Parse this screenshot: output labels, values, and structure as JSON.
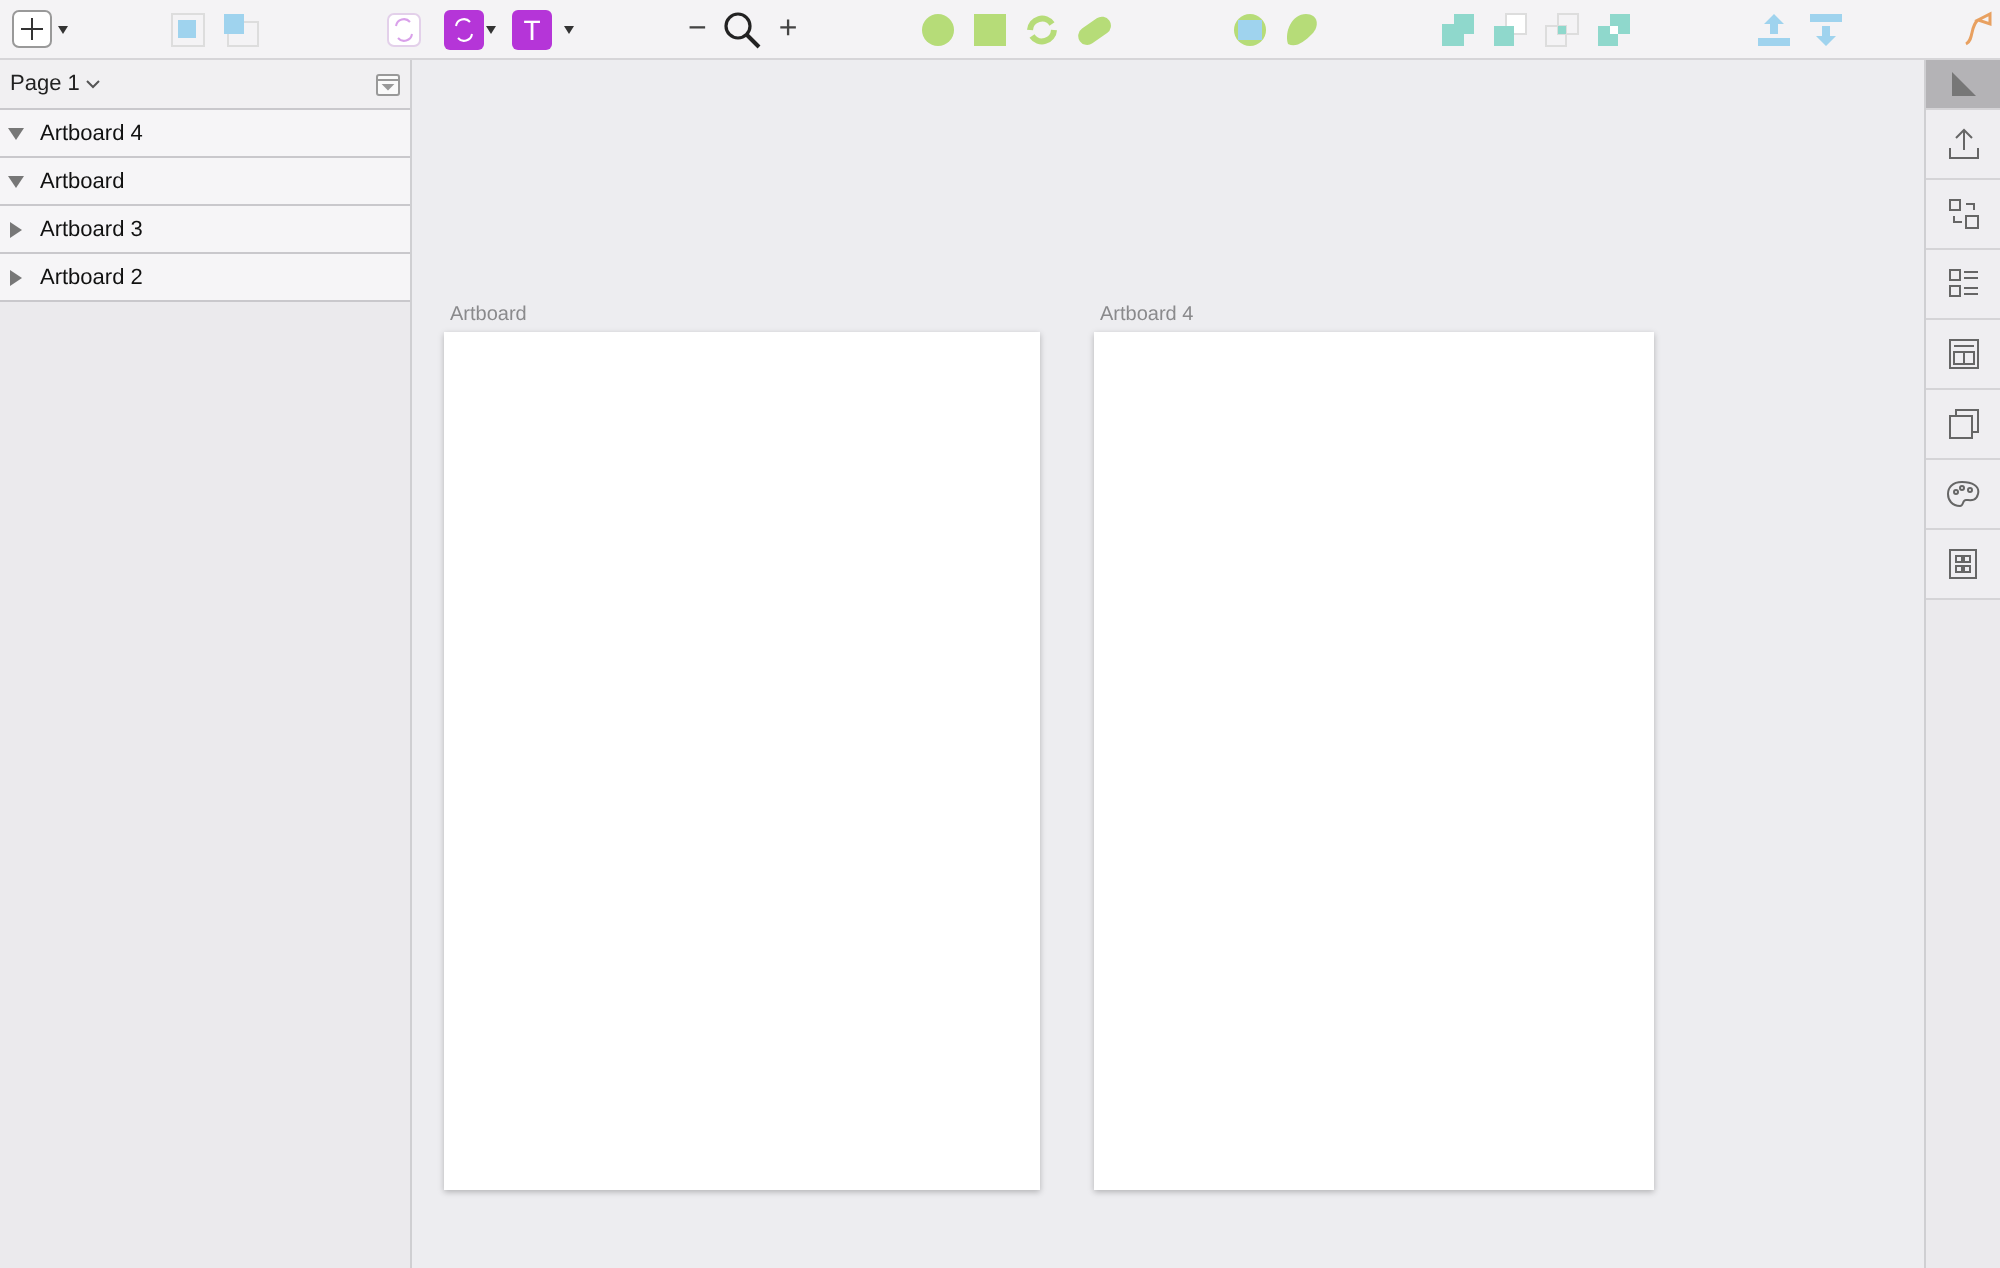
{
  "toolbar": {
    "text_tool": "T",
    "zoom_out": "−",
    "zoom_in": "+"
  },
  "layers": {
    "page": "Page 1",
    "items": [
      {
        "name": "Artboard 4",
        "expanded": true
      },
      {
        "name": "Artboard",
        "expanded": true
      },
      {
        "name": "Artboard 3",
        "expanded": false
      },
      {
        "name": "Artboard 2",
        "expanded": false
      }
    ]
  },
  "canvas": {
    "artboards": [
      {
        "label": "Artboard"
      },
      {
        "label": "Artboard 4"
      }
    ]
  },
  "right_panel": {
    "items": [
      {
        "kind": "ruler",
        "selected": true
      },
      {
        "kind": "export",
        "selected": false
      },
      {
        "kind": "swap",
        "selected": false
      },
      {
        "kind": "list",
        "selected": false
      },
      {
        "kind": "layout",
        "selected": false
      },
      {
        "kind": "stack",
        "selected": false
      },
      {
        "kind": "palette",
        "selected": false
      },
      {
        "kind": "grid",
        "selected": false
      }
    ]
  }
}
